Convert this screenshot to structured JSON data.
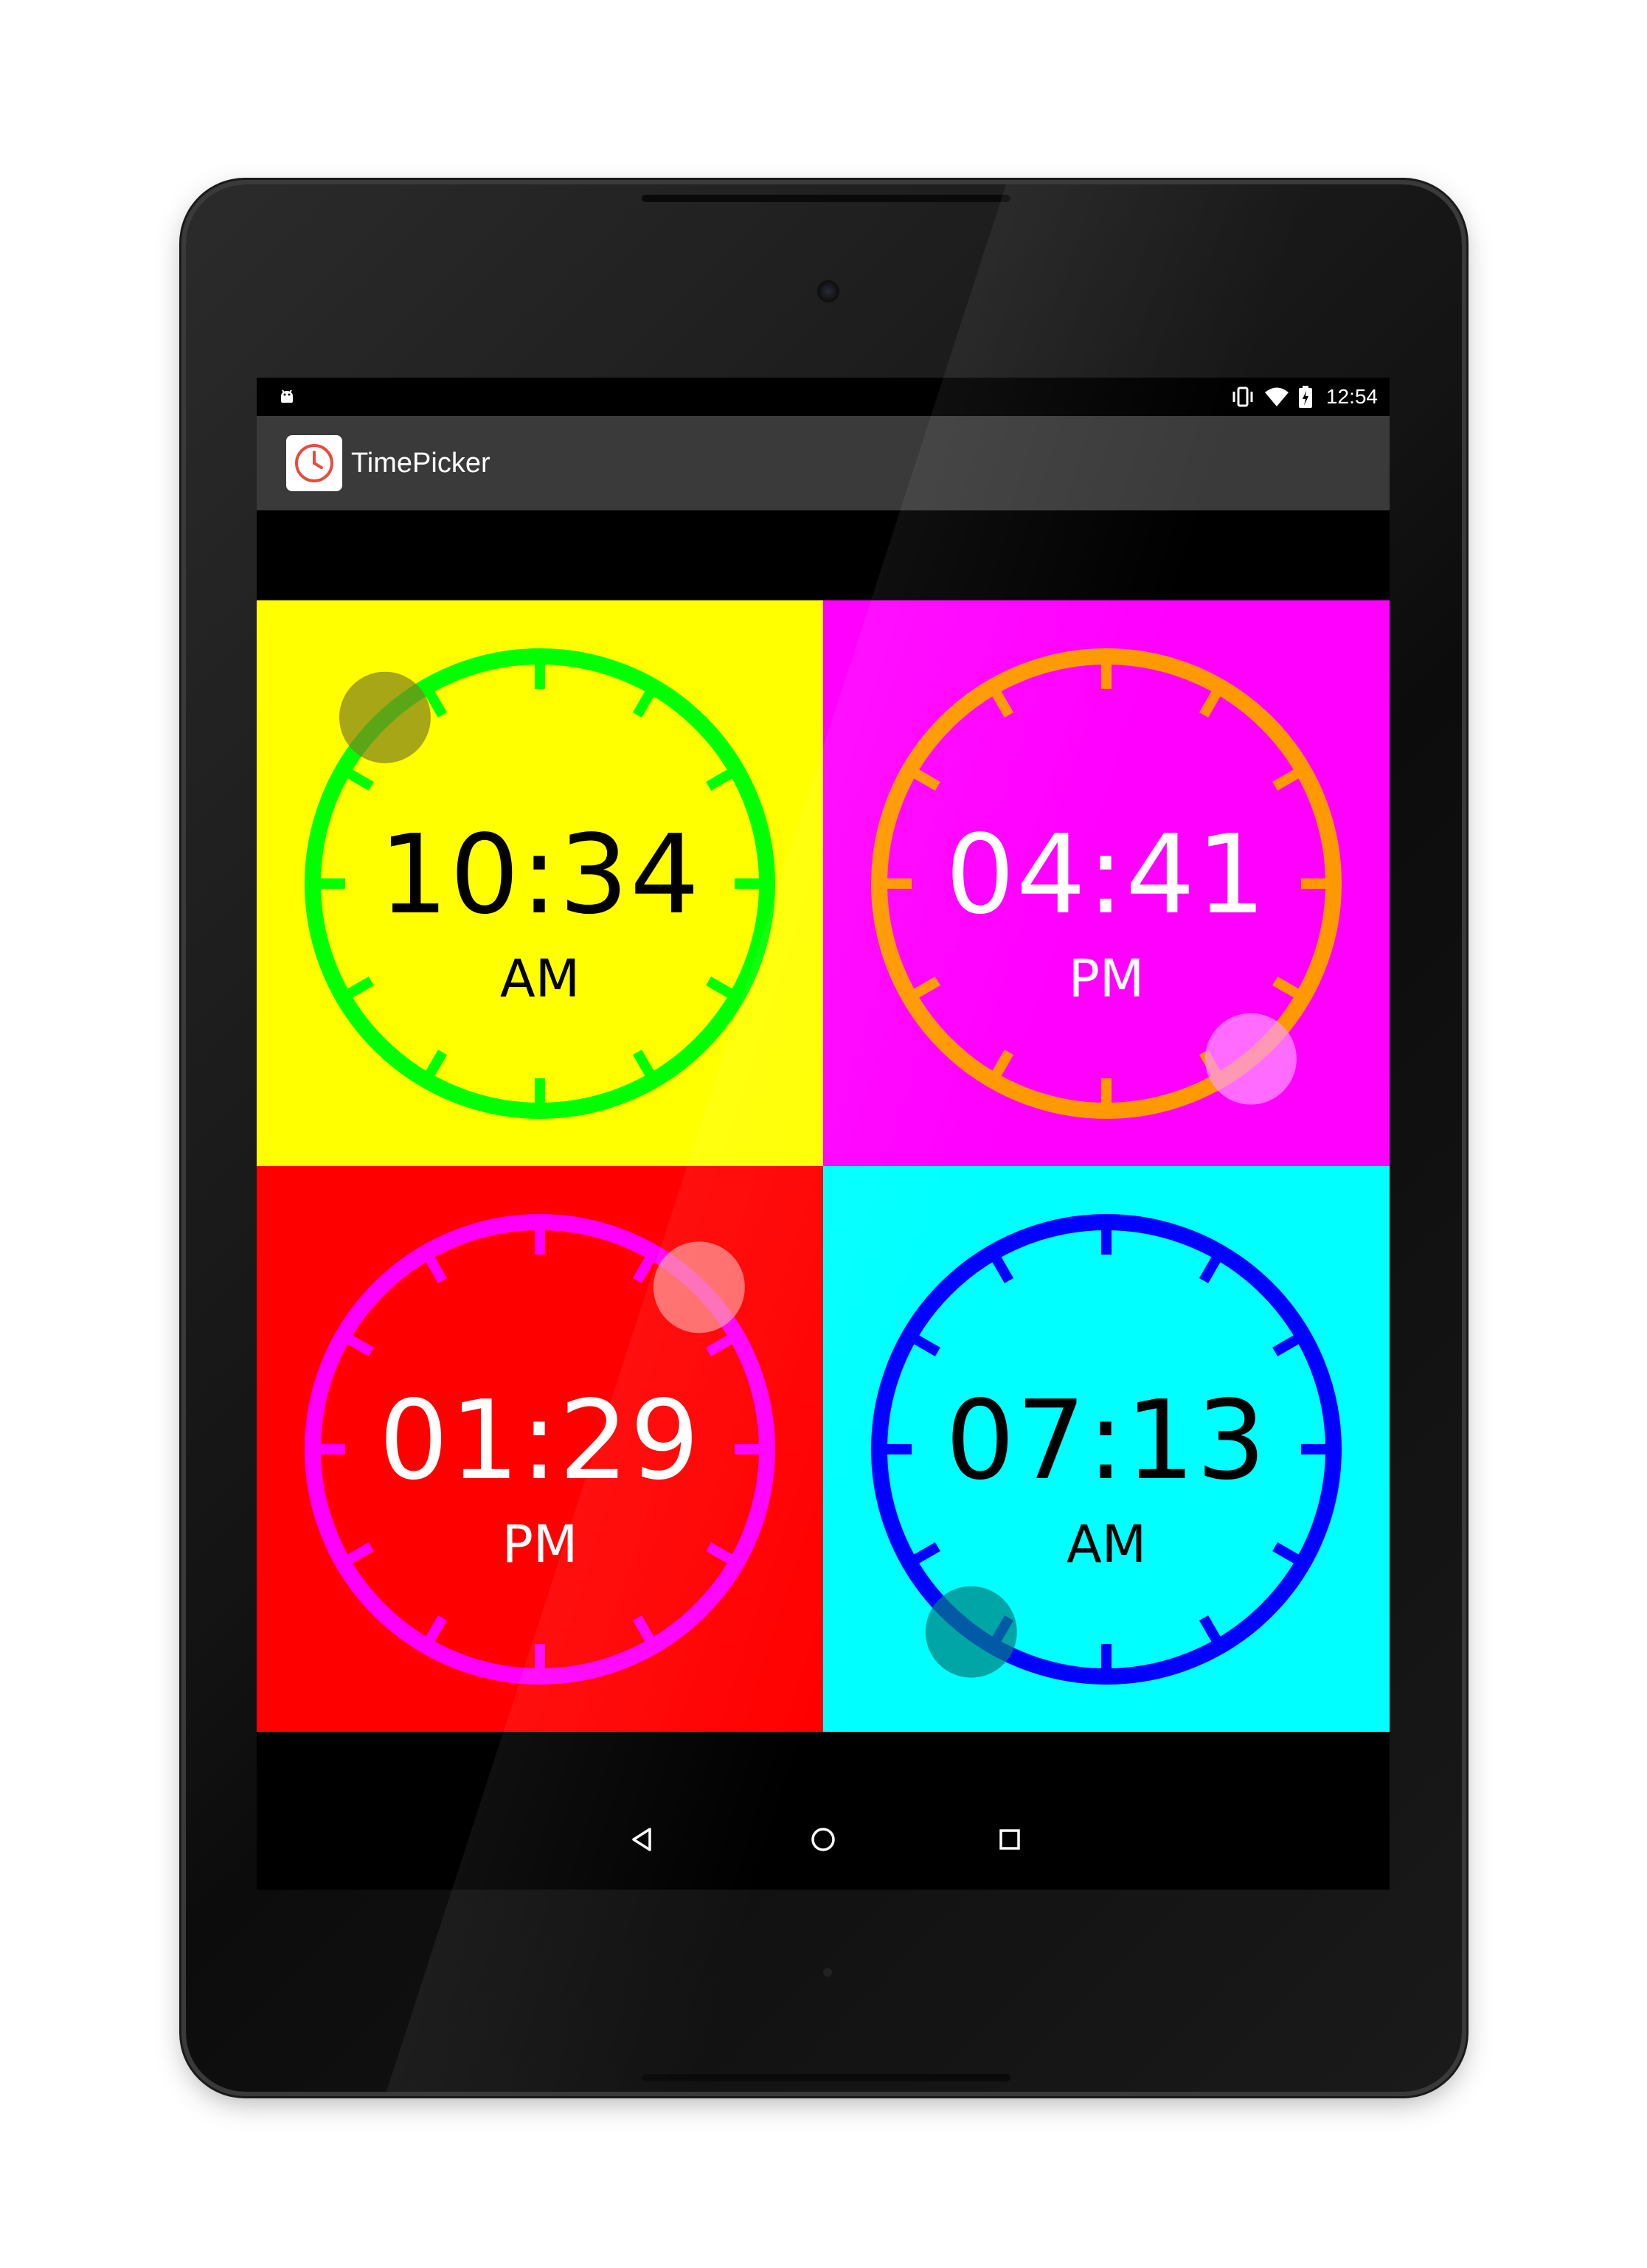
{
  "status_bar": {
    "time": "12:54",
    "left_icon": "android-debug-icon",
    "right_icons": [
      "vibrate-icon",
      "wifi-icon",
      "battery-charging-icon"
    ]
  },
  "action_bar": {
    "title": "TimePicker",
    "icon": "clock-icon"
  },
  "pickers": [
    {
      "time": "10:34",
      "period": "AM",
      "background": "#ffff00",
      "ring_color": "#00ff00",
      "text_color": "#000000",
      "handle_color": "#808020",
      "minute": 34,
      "hour": 10
    },
    {
      "time": "04:41",
      "period": "PM",
      "background": "#ff00ff",
      "ring_color": "#ff9900",
      "text_color": "#ffffff",
      "handle_color": "#ff99ff",
      "minute": 41,
      "hour": 4
    },
    {
      "time": "01:29",
      "period": "PM",
      "background": "#ff0000",
      "ring_color": "#ff00ff",
      "text_color": "#ffffff",
      "handle_color": "#ff9999",
      "minute": 29,
      "hour": 1
    },
    {
      "time": "07:13",
      "period": "AM",
      "background": "#00ffff",
      "ring_color": "#0000ff",
      "text_color": "#000000",
      "handle_color": "#008080",
      "minute": 13,
      "hour": 7
    }
  ],
  "nav_bar": {
    "back": "back-triangle-icon",
    "home": "home-circle-icon",
    "recents": "recents-square-icon"
  }
}
